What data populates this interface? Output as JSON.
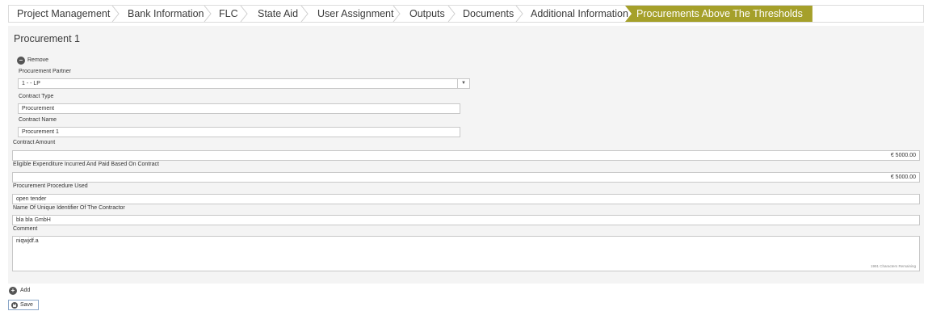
{
  "tabs": [
    {
      "label": "Project Management"
    },
    {
      "label": "Bank Information"
    },
    {
      "label": "FLC"
    },
    {
      "label": "State Aid"
    },
    {
      "label": "User Assignment"
    },
    {
      "label": "Outputs"
    },
    {
      "label": "Documents"
    },
    {
      "label": "Additional Information"
    },
    {
      "label": "Procurements Above The Thresholds",
      "active": true
    }
  ],
  "colors": {
    "active_tab": "#a5a02a",
    "panel_bg": "#f4f4f4",
    "save_border": "#8aa6c8"
  },
  "procurement": {
    "title": "Procurement 1",
    "remove_label": "Remove",
    "remove_icon": "minus-circle-icon",
    "partner": {
      "label": "Procurement Partner",
      "value": "1 - - LP",
      "arrow_icon": "dropdown-arrow-icon"
    },
    "contract_type": {
      "label": "Contract Type",
      "value": "Procurement"
    },
    "contract_name": {
      "label": "Contract Name",
      "value": "Procurement 1"
    },
    "contract_amount": {
      "label": "Contract Amount",
      "value": "€ 5000.00"
    },
    "eligible_expenditure": {
      "label": "Eligible Expenditure Incurred And Paid Based On Contract",
      "value": "€ 5000.00"
    },
    "procedure": {
      "label": "Procurement Procedure Used",
      "value": "open tender"
    },
    "contractor": {
      "label": "Name Of Unique Identifier Of The Contractor",
      "value": "bla bla GmbH"
    },
    "comment": {
      "label": "Comment",
      "value": "niqwjdf.a",
      "remaining": "1991 Characters Remaining"
    }
  },
  "actions": {
    "add_label": "Add",
    "add_icon": "plus-circle-icon",
    "save_label": "Save",
    "save_icon": "save-icon"
  }
}
